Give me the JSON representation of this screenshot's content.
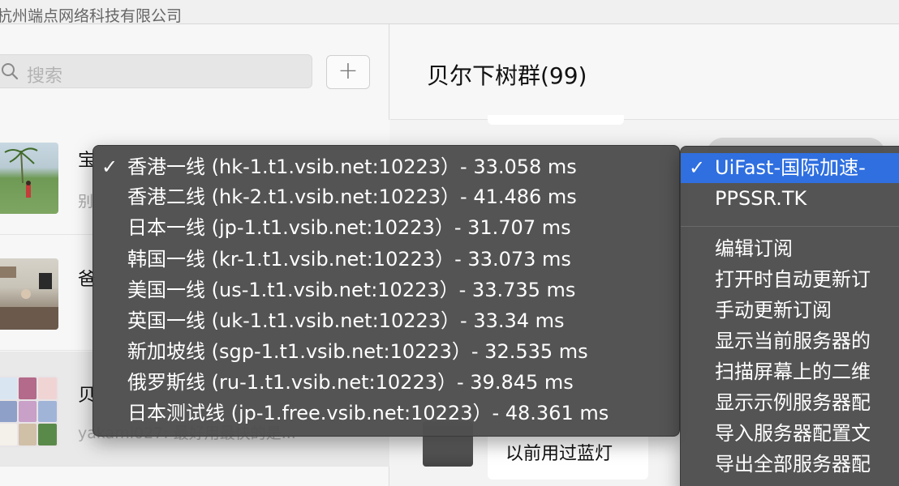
{
  "window": {
    "title": "杭州端点网络科技有限公司"
  },
  "sidebar": {
    "search_placeholder": "搜索",
    "add_button": "+",
    "chats": [
      {
        "name": "宝",
        "preview": "别"
      },
      {
        "name": "爸",
        "preview": ""
      },
      {
        "name": "贝",
        "preview": "yakami027: 最好用最快的是..."
      }
    ]
  },
  "conversation": {
    "title": "贝尔下树群(99)",
    "message": "以前用过蓝灯"
  },
  "server_menu": {
    "items": [
      {
        "label": "香港一线 (hk-1.t1.vsib.net:10223）- 33.058 ms",
        "checked": true
      },
      {
        "label": "香港二线 (hk-2.t1.vsib.net:10223）- 41.486 ms",
        "checked": false
      },
      {
        "label": "日本一线 (jp-1.t1.vsib.net:10223）- 31.707 ms",
        "checked": false
      },
      {
        "label": "韩国一线 (kr-1.t1.vsib.net:10223）- 33.073 ms",
        "checked": false
      },
      {
        "label": "美国一线 (us-1.t1.vsib.net:10223）- 33.735 ms",
        "checked": false
      },
      {
        "label": "英国一线 (uk-1.t1.vsib.net:10223）- 33.34 ms",
        "checked": false
      },
      {
        "label": "新加坡线 (sgp-1.t1.vsib.net:10223）- 32.535 ms",
        "checked": false
      },
      {
        "label": "俄罗斯线 (ru-1.t1.vsib.net:10223）- 39.845 ms",
        "checked": false
      },
      {
        "label": "日本测试线 (jp-1.free.vsib.net:10223）- 48.361 ms",
        "checked": false
      }
    ]
  },
  "sub_menu": {
    "groups": [
      {
        "label": "UiFast-国际加速-",
        "checked": true
      },
      {
        "label": "PPSSR.TK",
        "checked": false
      }
    ],
    "actions": [
      "编辑订阅",
      "打开时自动更新订",
      "手动更新订阅",
      "显示当前服务器的",
      "扫描屏幕上的二维",
      "显示示例服务器配",
      "导入服务器配置文",
      "导出全部服务器配"
    ]
  },
  "colors": {
    "menu_bg": "#4e4e4e",
    "selected": "#2f6fe0"
  }
}
